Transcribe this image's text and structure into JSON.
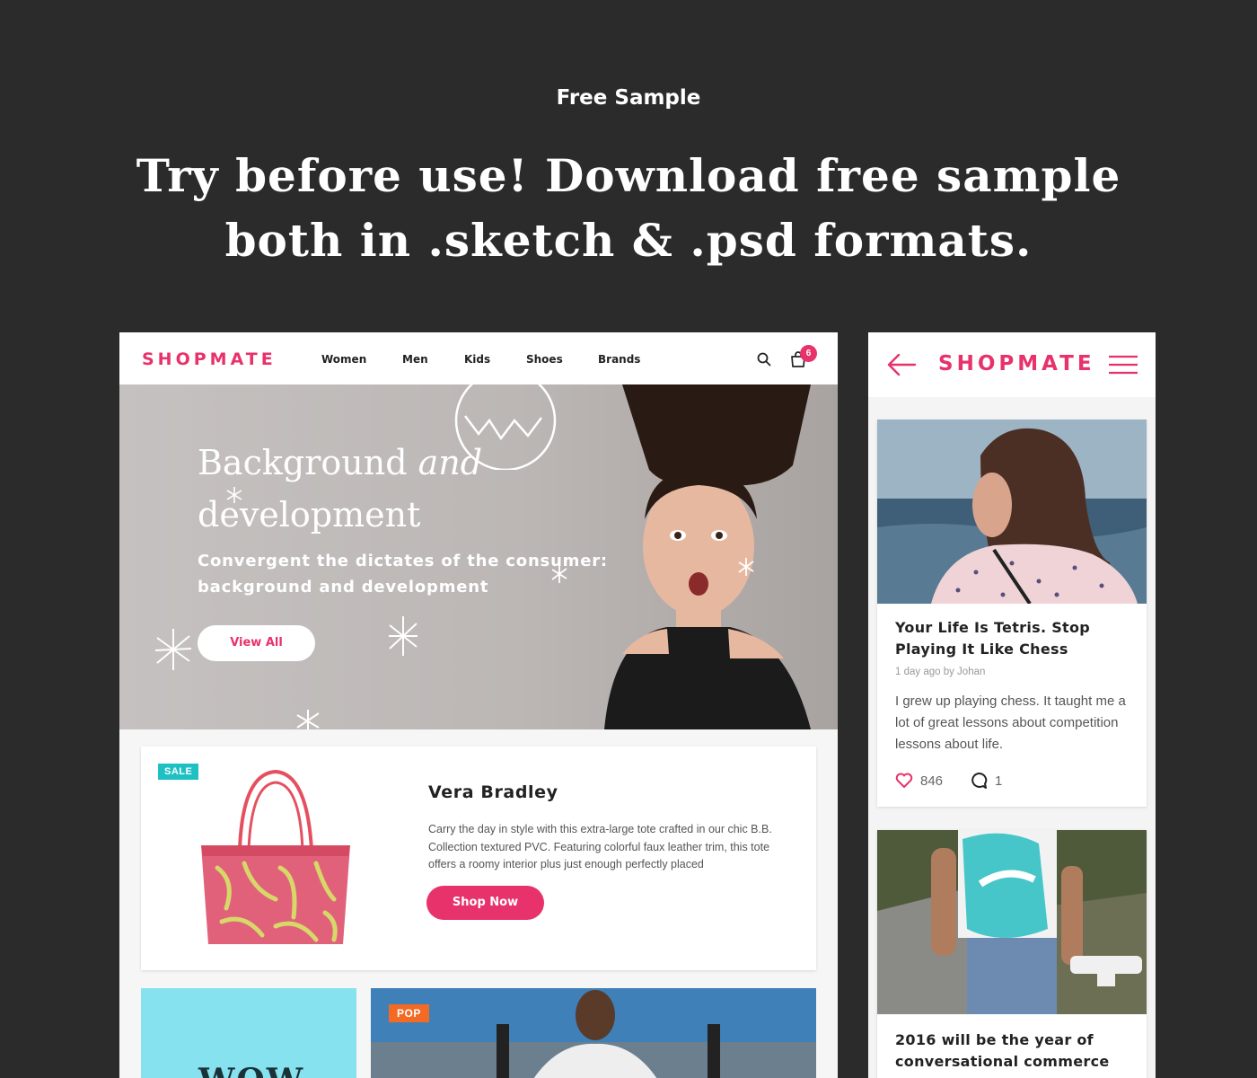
{
  "intro": {
    "label": "Free Sample",
    "title_line1": "Try before use! Download free sample",
    "title_line2": "both in .sketch & .psd formats."
  },
  "desktop": {
    "brand": "SHOPMATE",
    "nav": [
      "Women",
      "Men",
      "Kids",
      "Shoes",
      "Brands"
    ],
    "cart_count": "6",
    "hero": {
      "title_word1": "Background",
      "title_italic": "and",
      "title_word2": "development",
      "subtitle": "Convergent the dictates of the consumer: background and development",
      "button": "View All"
    },
    "product": {
      "badge": "SALE",
      "name": "Vera Bradley",
      "description": "Carry the day in style with this extra-large tote crafted in our chic B.B. Collection textured PVC. Featuring colorful faux leather trim, this tote offers a roomy interior plus just enough perfectly placed",
      "button": "Shop Now"
    },
    "tiles": {
      "wow": "WOW",
      "pop_badge": "POP"
    }
  },
  "mobile": {
    "brand": "SHOPMATE",
    "articles": [
      {
        "title": "Your Life Is Tetris. Stop Playing It Like Chess",
        "meta": "1 day ago by Johan",
        "body": "I grew up playing chess. It taught me a lot of great lessons about competition lessons about life.",
        "likes": "846",
        "comments": "1"
      },
      {
        "title": "2016 will be the year of conversational commerce"
      }
    ]
  },
  "colors": {
    "brand": "#e8326b",
    "background": "#2b2b2b",
    "sale_badge": "#1ec0c4",
    "pop_badge": "#f26a24",
    "wow_tile": "#86e2ef"
  }
}
